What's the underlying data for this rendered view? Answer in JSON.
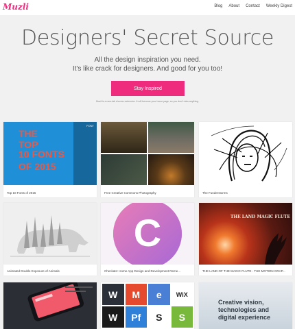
{
  "header": {
    "logo": "Muzli",
    "nav": [
      "Blog",
      "About",
      "Contact",
      "Weekly Digest"
    ]
  },
  "hero": {
    "title": "Designers' Secret Source",
    "subtitle_line1": "All the design inspiration you need.",
    "subtitle_line2": "It's like crack for designers. And good for you too!",
    "button_label": "Stay Inspired",
    "fine_print": "Muzli is a new-tab chrome extension. It will become your home page, so you don't miss anything."
  },
  "cards": [
    {
      "caption": "Top 10 Fonts of 2015",
      "art": {
        "line1": "THE",
        "line2": "TOP\n10 FONTS",
        "line3": "OF 2015",
        "tag": "FONT"
      }
    },
    {
      "caption": "Free Creative Commons Photography"
    },
    {
      "caption": "The Funderstorms"
    },
    {
      "caption": "Animated Double Exposure of Animals"
    },
    {
      "caption": "Checkats: Home App Design and Development Reme...",
      "art": {
        "letter": "C"
      }
    },
    {
      "caption": "THE LAND OF THE MAGIC FLUTE - THE MOTION GRAP...",
      "art": {
        "text": "THE LAND MAGIC FLUTE"
      }
    },
    {
      "caption": ""
    },
    {
      "caption": "",
      "art": {
        "tiles": [
          "W",
          "M",
          "e",
          "WiX",
          "W",
          "Pf",
          "S",
          "S"
        ]
      }
    },
    {
      "caption": "",
      "art": {
        "line1": "Creative vision,",
        "line2": "technologies and",
        "line3": "digital experience"
      }
    }
  ],
  "colors": {
    "accent": "#ee2b7d",
    "background": "#f1f1f1"
  }
}
